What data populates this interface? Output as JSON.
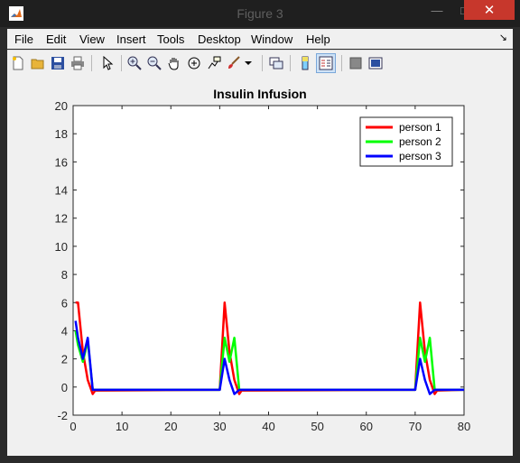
{
  "window": {
    "title": "Figure 3"
  },
  "menu": [
    "File",
    "Edit",
    "View",
    "Insert",
    "Tools",
    "Desktop",
    "Window",
    "Help"
  ],
  "toolbar": {
    "icons": [
      "new-figure-icon",
      "open-file-icon",
      "save-icon",
      "print-icon",
      "pointer-icon",
      "zoom-in-icon",
      "zoom-out-icon",
      "pan-icon",
      "rotate-3d-icon",
      "data-cursor-icon",
      "brush-icon",
      "brush-dropdown-icon",
      "link-plot-icon",
      "colorbar-icon",
      "legend-icon",
      "hide-plot-tools-icon",
      "show-plot-tools-icon"
    ]
  },
  "chart_data": {
    "type": "line",
    "title": "Insulin Infusion",
    "xlabel": "",
    "ylabel": "",
    "xlim": [
      0,
      80
    ],
    "ylim": [
      -2,
      20
    ],
    "xticks": [
      0,
      10,
      20,
      30,
      40,
      50,
      60,
      70,
      80
    ],
    "yticks": [
      -2,
      0,
      2,
      4,
      6,
      8,
      10,
      12,
      14,
      16,
      18,
      20
    ],
    "legend_position": "top-right",
    "series": [
      {
        "name": "person 1",
        "color": "#ff0000",
        "x": [
          0.5,
          1,
          2,
          3,
          4,
          4.5,
          30,
          31,
          32,
          33,
          34,
          34.5,
          70,
          71,
          72,
          73,
          74,
          74.5,
          80
        ],
        "y": [
          6,
          6,
          2.5,
          0.5,
          -0.5,
          -0.25,
          -0.2,
          6,
          2.5,
          0.5,
          -0.5,
          -0.25,
          -0.2,
          6,
          2.5,
          0.5,
          -0.5,
          -0.25,
          -0.2
        ]
      },
      {
        "name": "person 2",
        "color": "#00ff00",
        "x": [
          0.5,
          1,
          2,
          3,
          4,
          30,
          31,
          32,
          33,
          34,
          70,
          71,
          72,
          73,
          74,
          80
        ],
        "y": [
          4,
          3,
          1.8,
          3.3,
          -0.2,
          -0.2,
          3.5,
          1.8,
          3.5,
          -0.2,
          -0.2,
          3.5,
          1.8,
          3.5,
          -0.2,
          -0.2
        ]
      },
      {
        "name": "person 3",
        "color": "#0000ff",
        "x": [
          0.5,
          1,
          2,
          3,
          4,
          30,
          31,
          32,
          33,
          34,
          70,
          71,
          72,
          73,
          74,
          80
        ],
        "y": [
          4.7,
          3.5,
          2,
          3.5,
          -0.2,
          -0.2,
          2,
          0.5,
          -0.5,
          -0.2,
          -0.2,
          2,
          0.5,
          -0.5,
          -0.2,
          -0.2
        ]
      }
    ]
  }
}
